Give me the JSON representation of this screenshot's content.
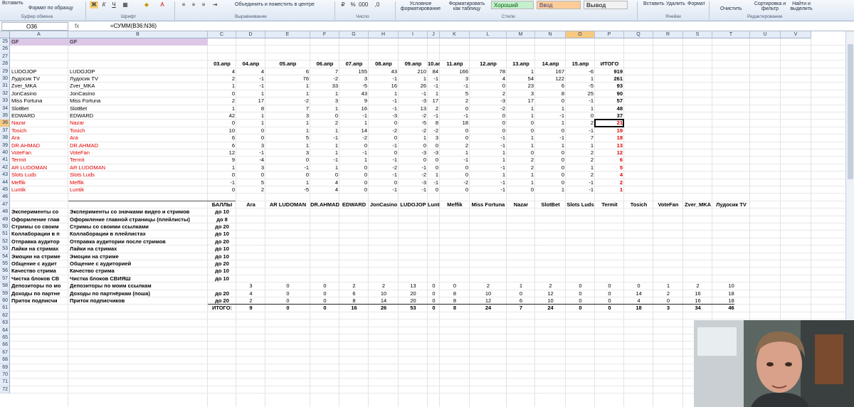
{
  "ribbon": {
    "paste": "Вставить",
    "format_painter": "Формат по образцу",
    "bold": "Ж",
    "italic": "К",
    "underline": "Ч",
    "merge": "Объединить и поместить в центре",
    "conditional": "Условное форматирование",
    "format_table": "Форматировать как таблицу",
    "style_good": "Хороший",
    "style_neutral": "Ввод",
    "style_output": "Вывод",
    "insert": "Вставить",
    "delete": "Удалить",
    "format": "Формат",
    "clear": "Очистить",
    "sort": "Сортировка и фильтр",
    "find": "Найти и выделить",
    "groups": [
      "Буфер обмена",
      "Шрифт",
      "Выравнивание",
      "Число",
      "Стили",
      "Ячейки",
      "Редактирование"
    ]
  },
  "formula_bar": {
    "name_box": "O36",
    "fx": "fx",
    "formula": "=СУММ(B36:N36)"
  },
  "columns": [
    "A",
    "B",
    "C",
    "D",
    "E",
    "F",
    "G",
    "H",
    "I",
    "J",
    "K",
    "L",
    "M",
    "N",
    "O",
    "P",
    "Q",
    "R",
    "S",
    "T",
    "U",
    "V"
  ],
  "rows": [
    "25",
    "26",
    "27",
    "28",
    "29",
    "30",
    "31",
    "32",
    "33",
    "34",
    "35",
    "36",
    "37",
    "38",
    "39",
    "40",
    "41",
    "42",
    "43",
    "44",
    "45",
    "46",
    "47",
    "48",
    "49",
    "50",
    "51",
    "52",
    "53",
    "54",
    "55",
    "56",
    "57",
    "58",
    "59",
    "60",
    "61",
    "62",
    "63",
    "64",
    "65",
    "66",
    "67",
    "68",
    "69",
    "70",
    "71",
    "72"
  ],
  "gf_label": "GF",
  "date_headers": [
    "03.апр",
    "04.апр",
    "05.апр",
    "06.апр",
    "07.апр",
    "08.апр",
    "09.апр",
    "10.апр",
    "11.апр",
    "12.апр",
    "13.апр",
    "14.апр",
    "15.апр",
    "ИТОГО"
  ],
  "players": [
    {
      "name": "LUDOJOP",
      "red": false,
      "v": [
        "4",
        "4",
        "6",
        "7",
        "155",
        "43",
        "210",
        "84",
        "166",
        "78",
        "1",
        "167",
        "-6",
        "919"
      ]
    },
    {
      "name": "Лудосик TV",
      "red": false,
      "v": [
        "2",
        "-1",
        "76",
        "-2",
        "3",
        "-1",
        "1",
        "-1",
        "3",
        "4",
        "54",
        "122",
        "1",
        "261"
      ]
    },
    {
      "name": "Zver_MKA",
      "red": false,
      "v": [
        "1",
        "-1",
        "1",
        "33",
        "-5",
        "16",
        "26",
        "-1",
        "-1",
        "0",
        "23",
        "6",
        "-5",
        "93"
      ]
    },
    {
      "name": "JonCasino",
      "red": false,
      "v": [
        "0",
        "1",
        "1",
        "1",
        "43",
        "1",
        "-1",
        "1",
        "5",
        "2",
        "3",
        "8",
        "25",
        "90"
      ]
    },
    {
      "name": "Miss Fortuna",
      "red": false,
      "v": [
        "2",
        "17",
        "-2",
        "3",
        "9",
        "-1",
        "-3",
        "17",
        "2",
        "-3",
        "17",
        "0",
        "-1",
        "57"
      ]
    },
    {
      "name": "SlotBet",
      "red": false,
      "v": [
        "1",
        "8",
        "7",
        "1",
        "16",
        "-1",
        "13",
        "2",
        "0",
        "-2",
        "1",
        "1",
        "1",
        "48"
      ]
    },
    {
      "name": "EDWARD",
      "red": false,
      "v": [
        "42",
        "1",
        "3",
        "0",
        "-1",
        "-3",
        "-2",
        "-1",
        "-1",
        "0",
        "1",
        "-1",
        "0",
        "37"
      ]
    },
    {
      "name": "Nazar",
      "red": true,
      "v": [
        "0",
        "1",
        "1",
        "2",
        "1",
        "0",
        "-5",
        "8",
        "18",
        "0",
        "0",
        "1",
        "2",
        "21"
      ]
    },
    {
      "name": "Tosich",
      "red": true,
      "v": [
        "10",
        "0",
        "1",
        "1",
        "14",
        "-2",
        "-2",
        "-2",
        "0",
        "0",
        "0",
        "0",
        "-1",
        "19"
      ]
    },
    {
      "name": "Ara",
      "red": true,
      "v": [
        "6",
        "0",
        "5",
        "-1",
        "-2",
        "0",
        "1",
        "3",
        "0",
        "-1",
        "1",
        "-1",
        "7",
        "18"
      ]
    },
    {
      "name": "DR.AHMAD",
      "red": true,
      "v": [
        "6",
        "3",
        "1",
        "1",
        "0",
        "-1",
        "0",
        "0",
        "2",
        "-1",
        "1",
        "1",
        "1",
        "13"
      ]
    },
    {
      "name": "VoteFan",
      "red": true,
      "v": [
        "12",
        "-1",
        "3",
        "1",
        "-1",
        "0",
        "-3",
        "-3",
        "1",
        "1",
        "0",
        "0",
        "2",
        "12"
      ]
    },
    {
      "name": "Termit",
      "red": true,
      "v": [
        "9",
        "-4",
        "0",
        "-1",
        "1",
        "-1",
        "0",
        "0",
        "-1",
        "1",
        "2",
        "0",
        "2",
        "6"
      ]
    },
    {
      "name": "AR LUDOMAN",
      "red": true,
      "v": [
        "1",
        "3",
        "-1",
        "1",
        "0",
        "-2",
        "-1",
        "0",
        "0",
        "-1",
        "2",
        "0",
        "1",
        "5"
      ]
    },
    {
      "name": "Slots Luds",
      "red": true,
      "v": [
        "0",
        "0",
        "0",
        "0",
        "0",
        "-1",
        "-2",
        "1",
        "0",
        "1",
        "1",
        "0",
        "2",
        "4"
      ]
    },
    {
      "name": "Meffik",
      "red": true,
      "v": [
        "-1",
        "5",
        "1",
        "4",
        "0",
        "0",
        "-3",
        "-1",
        "-2",
        "-1",
        "1",
        "0",
        "-1",
        "2"
      ]
    },
    {
      "name": "Luntik",
      "red": true,
      "v": [
        "0",
        "2",
        "-5",
        "4",
        "0",
        "-1",
        "-1",
        "0",
        "0",
        "-1",
        "0",
        "1",
        "-1",
        "1"
      ]
    }
  ],
  "score_header": {
    "label": "БАЛЛЫ",
    "names": [
      "Ara",
      "AR LUDOMAN",
      "DR.AHMAD",
      "EDWARD",
      "JonCasino",
      "LUDOJOP",
      "Luntik",
      "Meffik",
      "Miss Fortuna",
      "Nazar",
      "SlotBet",
      "Slots Luds",
      "Termit",
      "Tosich",
      "VoteFan",
      "Zver_MKA",
      "Лудосик TV"
    ]
  },
  "criteria": [
    {
      "a": "Эксперименты со",
      "b": "Эксперименты со значками видео и стримов",
      "max": "до 10"
    },
    {
      "a": "Оформление глав",
      "b": "Оформление главной страницы (плейлисты)",
      "max": "до 8"
    },
    {
      "a": "Стримы со своим",
      "b": "Стримы со своими ссылками",
      "max": "до 20"
    },
    {
      "a": "Коллаборации в п",
      "b": "Коллаборации в плейлистах",
      "max": "до 10"
    },
    {
      "a": "Отправка аудитор",
      "b": "Отправка аудитории после стримов",
      "max": "до 20"
    },
    {
      "a": "Лайки на стримах",
      "b": "Лайки на стримах",
      "max": "до 10"
    },
    {
      "a": "Эмоции на стриме",
      "b": "Эмоции на стриме",
      "max": "до 10"
    },
    {
      "a": "Общение с аудит",
      "b": "Общение с аудиторией",
      "max": "до 20"
    },
    {
      "a": "Качество стрима",
      "b": "Качество стрима",
      "max": "до 10"
    },
    {
      "a": "Чистка блоков СВ",
      "b": "Чистка блоков СВИЯШ",
      "max": "до 10"
    }
  ],
  "score_rows": [
    {
      "a": "Депозиторы по мо",
      "b": "Депозиторы по моим ссылкам",
      "max": "",
      "v": [
        "3",
        "0",
        "0",
        "2",
        "2",
        "13",
        "0",
        "0",
        "2",
        "1",
        "2",
        "0",
        "0",
        "0",
        "1",
        "2",
        "10"
      ]
    },
    {
      "a": "Доходы по партне",
      "b": "Доходы по партнёркам (поша)",
      "max": "до 20",
      "v": [
        "4",
        "0",
        "0",
        "6",
        "10",
        "20",
        "0",
        "8",
        "10",
        "0",
        "12",
        "0",
        "0",
        "14",
        "2",
        "16",
        "18"
      ]
    },
    {
      "a": "Приток подписчи",
      "b": "Приток подписчиков",
      "max": "до 20",
      "v": [
        "2",
        "0",
        "0",
        "8",
        "14",
        "20",
        "0",
        "8",
        "12",
        "6",
        "10",
        "0",
        "0",
        "4",
        "0",
        "16",
        "18"
      ]
    }
  ],
  "totals": {
    "label": "ИТОГО:",
    "v": [
      "9",
      "0",
      "0",
      "16",
      "26",
      "53",
      "0",
      "8",
      "24",
      "7",
      "24",
      "0",
      "0",
      "18",
      "3",
      "34",
      "46"
    ]
  },
  "webcam": {
    "description": "webcam overlay of presenter"
  }
}
